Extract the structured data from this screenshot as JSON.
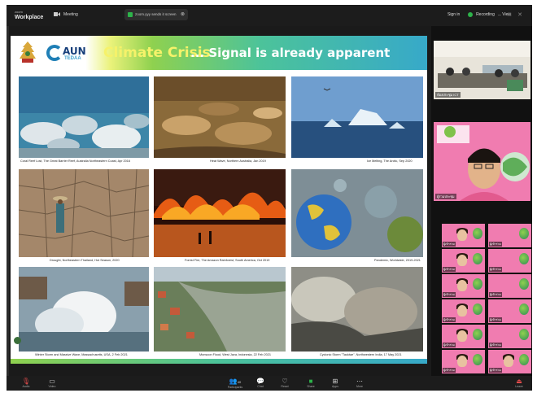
{
  "topbar": {
    "app_small": "zoom",
    "app_name": "Workplace",
    "meeting_label": "Meeting",
    "share_text": "zoom.yyy sends it screen",
    "sign_in": "Sign in",
    "recording": "Recording",
    "view": "View"
  },
  "slide": {
    "logo_text": "AUN",
    "logo_sub": "TEDAA",
    "title_highlight": "Climate Crisis",
    "title_rest": "... Signal is already apparent",
    "photos": [
      {
        "caption": "Coral Reef Lost, The Great Barrier Reef, Australia Northeastern Coast, Apr 2016",
        "theme": "coral-reef"
      },
      {
        "caption": "Heat Wave, Northern Australia, Jan 2019",
        "theme": "heat-wave"
      },
      {
        "caption": "Ice Melting, The Arctic, Sep 2020",
        "theme": "ice-melting"
      },
      {
        "caption": "Drought, Northeastern Thailand, Hot Season, 2020",
        "theme": "drought"
      },
      {
        "caption": "Forest Fire, The Amazon Rainforest, South America, Oct 2019",
        "theme": "forest-fire"
      },
      {
        "caption": "Pandemic, Worldwide, 2019-2021",
        "theme": "pandemic"
      },
      {
        "caption": "Winter Storm and Massive Wave, Massachusetts, USA, 2 Feb 2021",
        "theme": "winter-storm"
      },
      {
        "caption": "Monsoon Flood, West Java, Indonesia, 22 Feb 2021",
        "theme": "monsoon-flood"
      },
      {
        "caption": "Cyclonic Storm \"Tauktae\", Northwestern India, 17 May 2021",
        "theme": "cyclone"
      }
    ]
  },
  "videos": {
    "tile1_name": "ห้องประชุม ICT",
    "tile2_name": "ผู้ร่วมประชุม"
  },
  "gallery": [
    {
      "label": "ผู้เข้าร่วม"
    },
    {
      "label": "ผู้เข้าร่วม"
    },
    {
      "label": "ผู้เข้าร่วม"
    },
    {
      "label": "ผู้เข้าร่วม"
    },
    {
      "label": "ผู้เข้าร่วม"
    },
    {
      "label": "ผู้เข้าร่วม"
    },
    {
      "label": "ผู้เข้าร่วม"
    },
    {
      "label": "ผู้เข้าร่วม"
    },
    {
      "label": "ผู้เข้าร่วม"
    },
    {
      "label": "ผู้เข้าร่วม"
    },
    {
      "label": "ผู้เข้าร่วม"
    },
    {
      "label": "ผู้เข้าร่วม"
    }
  ],
  "bottombar": {
    "audio": "Audio",
    "video": "Video",
    "participants": "Participants",
    "participants_count": "40",
    "chat": "Chat",
    "react": "React",
    "share": "Share",
    "apps": "Apps",
    "more": "More",
    "leave": "Leave"
  },
  "colors": {
    "accent_green": "#2db34a",
    "gallery_pink": "#f07cb0",
    "banner_yellow": "#f6f26a"
  }
}
